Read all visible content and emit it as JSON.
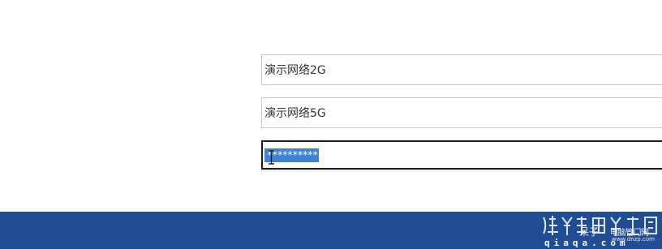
{
  "form": {
    "ssid_2g": {
      "value": "演示网络2G"
    },
    "ssid_5g": {
      "value": "演示网络5G"
    },
    "password": {
      "value": "**********"
    }
  },
  "watermark": {
    "brand_name": "呆子",
    "site_name": "电脑管门网",
    "site_url": "www.dnzp.com",
    "domain": "qiaqa.com"
  },
  "colors": {
    "footer_background": "#214d94",
    "selection_highlight": "#3f83d6"
  },
  "icons": {
    "cursor": "i-beam-cursor-icon",
    "logo": "watermark-logo-icon"
  }
}
